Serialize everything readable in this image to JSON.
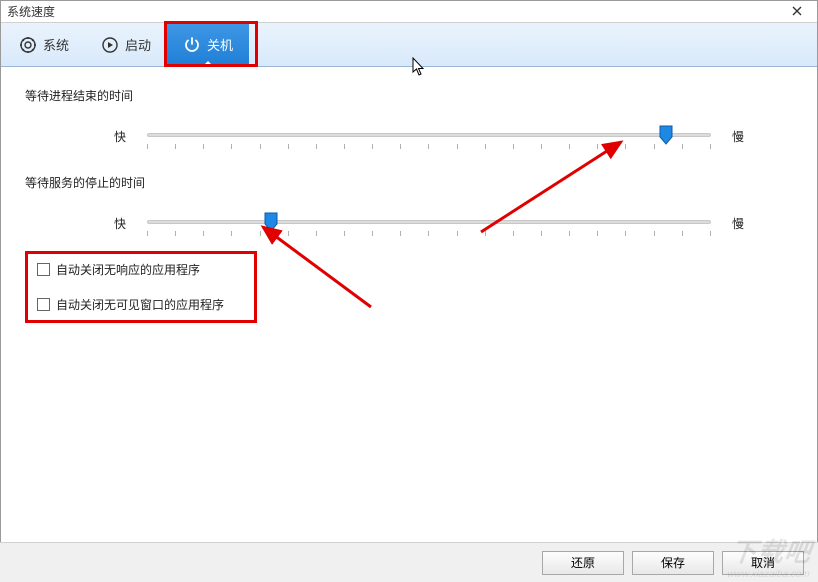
{
  "title": "系统速度",
  "tabs": {
    "system": "系统",
    "startup": "启动",
    "shutdown": "关机"
  },
  "group1_title": "等待进程结束的时间",
  "group2_title": "等待服务的停止的时间",
  "slider_labels": {
    "fast": "快",
    "slow": "慢"
  },
  "slider1": {
    "position_pct": 92
  },
  "slider2": {
    "position_pct": 22
  },
  "checkbox1": "自动关闭无响应的应用程序",
  "checkbox2": "自动关闭无可见窗口的应用程序",
  "buttons": {
    "restore": "还原",
    "save": "保存",
    "cancel": "取消"
  },
  "watermark": "下载吧",
  "watermark_url": "www.xiazaiba.com",
  "annotations": {
    "highlighted_tab": "shutdown",
    "highlighted_checkboxes": true,
    "arrows_to_sliders": true
  }
}
